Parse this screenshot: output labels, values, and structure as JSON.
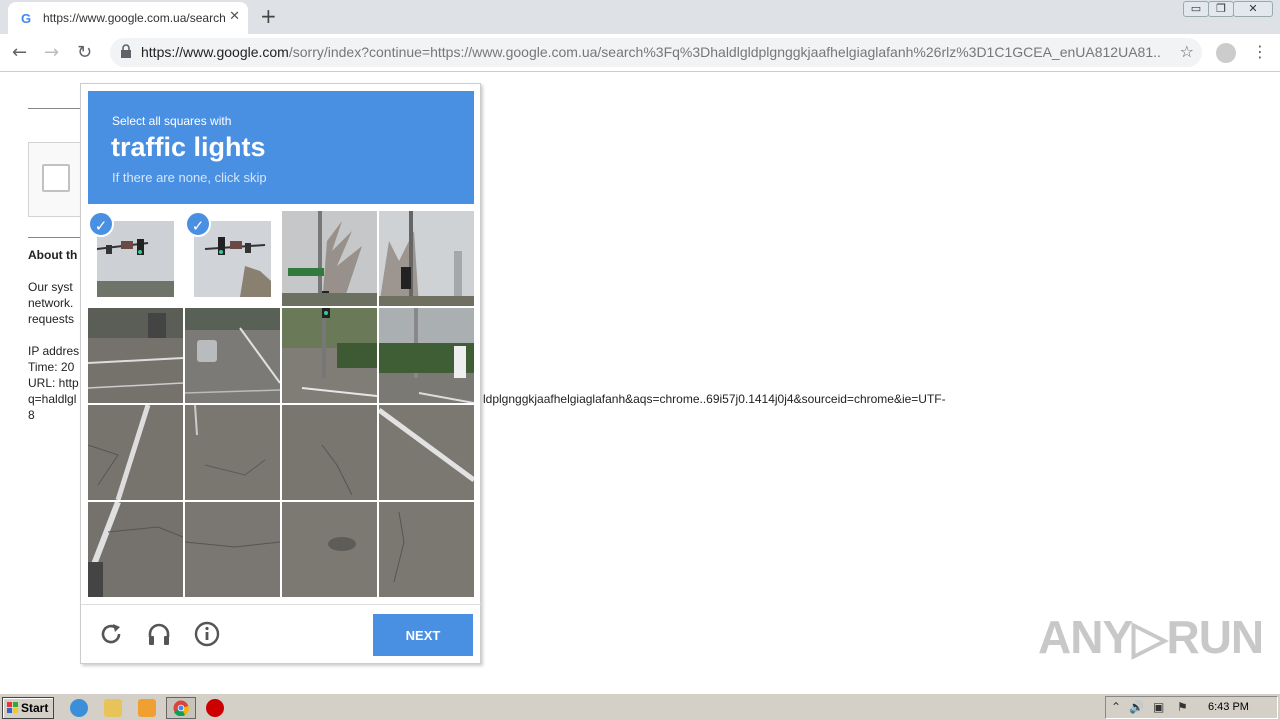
{
  "browser": {
    "tab_title": "https://www.google.com.ua/search?q=",
    "tab_favicon": "G",
    "close_glyph": "✕",
    "new_tab_glyph": "+",
    "url_host": "https://www.google.com",
    "url_rest": "/sorry/index?continue=https://www.google.com.ua/search%3Fq%3Dhaldlgldplgnggkjaafhelgiaglafanh%26rlz%3D1C1GCEA_enUA812UA81...",
    "back_glyph": "←",
    "forward_glyph": "→",
    "reload_glyph": "↻",
    "star_glyph": "☆",
    "menu_glyph": "⋮",
    "window_buttons": [
      "▭",
      "❐",
      "✕"
    ]
  },
  "page": {
    "about_heading": "About th",
    "body_lines": [
      "Our syst",
      "network.",
      "requests"
    ],
    "ip_label": "IP addres",
    "time_label": "Time: 20",
    "url_label": "URL: http",
    "query_line_start": "q=haldlgl",
    "query_line_end": "ldplgnggkjaafhelgiaglafanh&aqs=chrome..69i57j0.1414j0j4&sourceid=chrome&ie=UTF-",
    "query_wrap": "8"
  },
  "captcha": {
    "instruction": "Select all squares with",
    "target": "traffic lights",
    "hint": "If there are none, click skip",
    "selected_tiles": [
      0,
      1
    ],
    "check_glyph": "✓",
    "next_label": "NEXT",
    "colors": {
      "accent": "#4a90e2"
    }
  },
  "watermark": "ANY▷RUN",
  "taskbar": {
    "start_label": "Start",
    "clock": "6:43 PM",
    "tray_glyphs": [
      "⌃",
      "🔊",
      "▣",
      "⚑"
    ]
  }
}
